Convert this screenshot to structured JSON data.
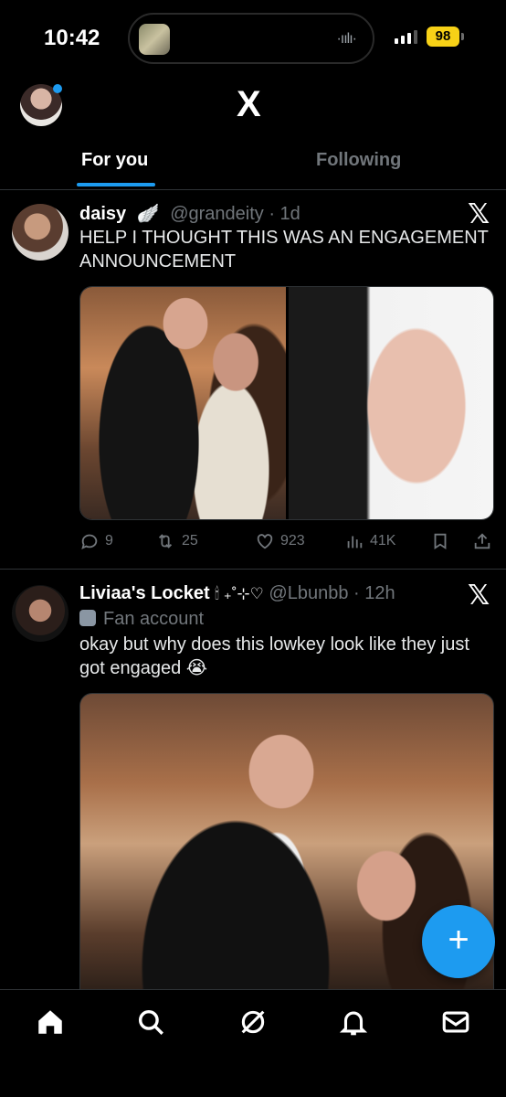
{
  "status_bar": {
    "time": "10:42",
    "battery": "98",
    "island_icon": "audio-waveform-icon"
  },
  "header": {
    "logo": "X",
    "tabs": [
      {
        "label": "For you",
        "active": true
      },
      {
        "label": "Following",
        "active": false
      }
    ]
  },
  "tweets": [
    {
      "name": "daisy",
      "badge_icon": "feather-wing-icon",
      "handle": "@grandeity",
      "time": "· 1d",
      "text": "HELP I THOUGHT THIS WAS AN ENGAGEMENT ANNOUNCEMENT",
      "media": [
        "couple-photo",
        "ring-closeup-photo"
      ],
      "replies": "9",
      "reposts": "25",
      "likes": "923",
      "views": "41K"
    },
    {
      "name": "Liviaa's Locket",
      "name_decor": "🕯 ₊˚⊹♡",
      "handle": "@Lbunbb",
      "time": "· 12h",
      "label": "Fan account",
      "text": "okay but why does this lowkey look like they just got engaged 😭",
      "media": [
        "couple-photo"
      ]
    }
  ],
  "fab": {
    "label": "+"
  },
  "nav": [
    "home-icon",
    "search-icon",
    "grok-icon",
    "notifications-icon",
    "messages-icon"
  ],
  "colors": {
    "accent": "#1d9bf0",
    "background": "#000000",
    "muted": "#71767b",
    "battery": "#f7d117"
  }
}
